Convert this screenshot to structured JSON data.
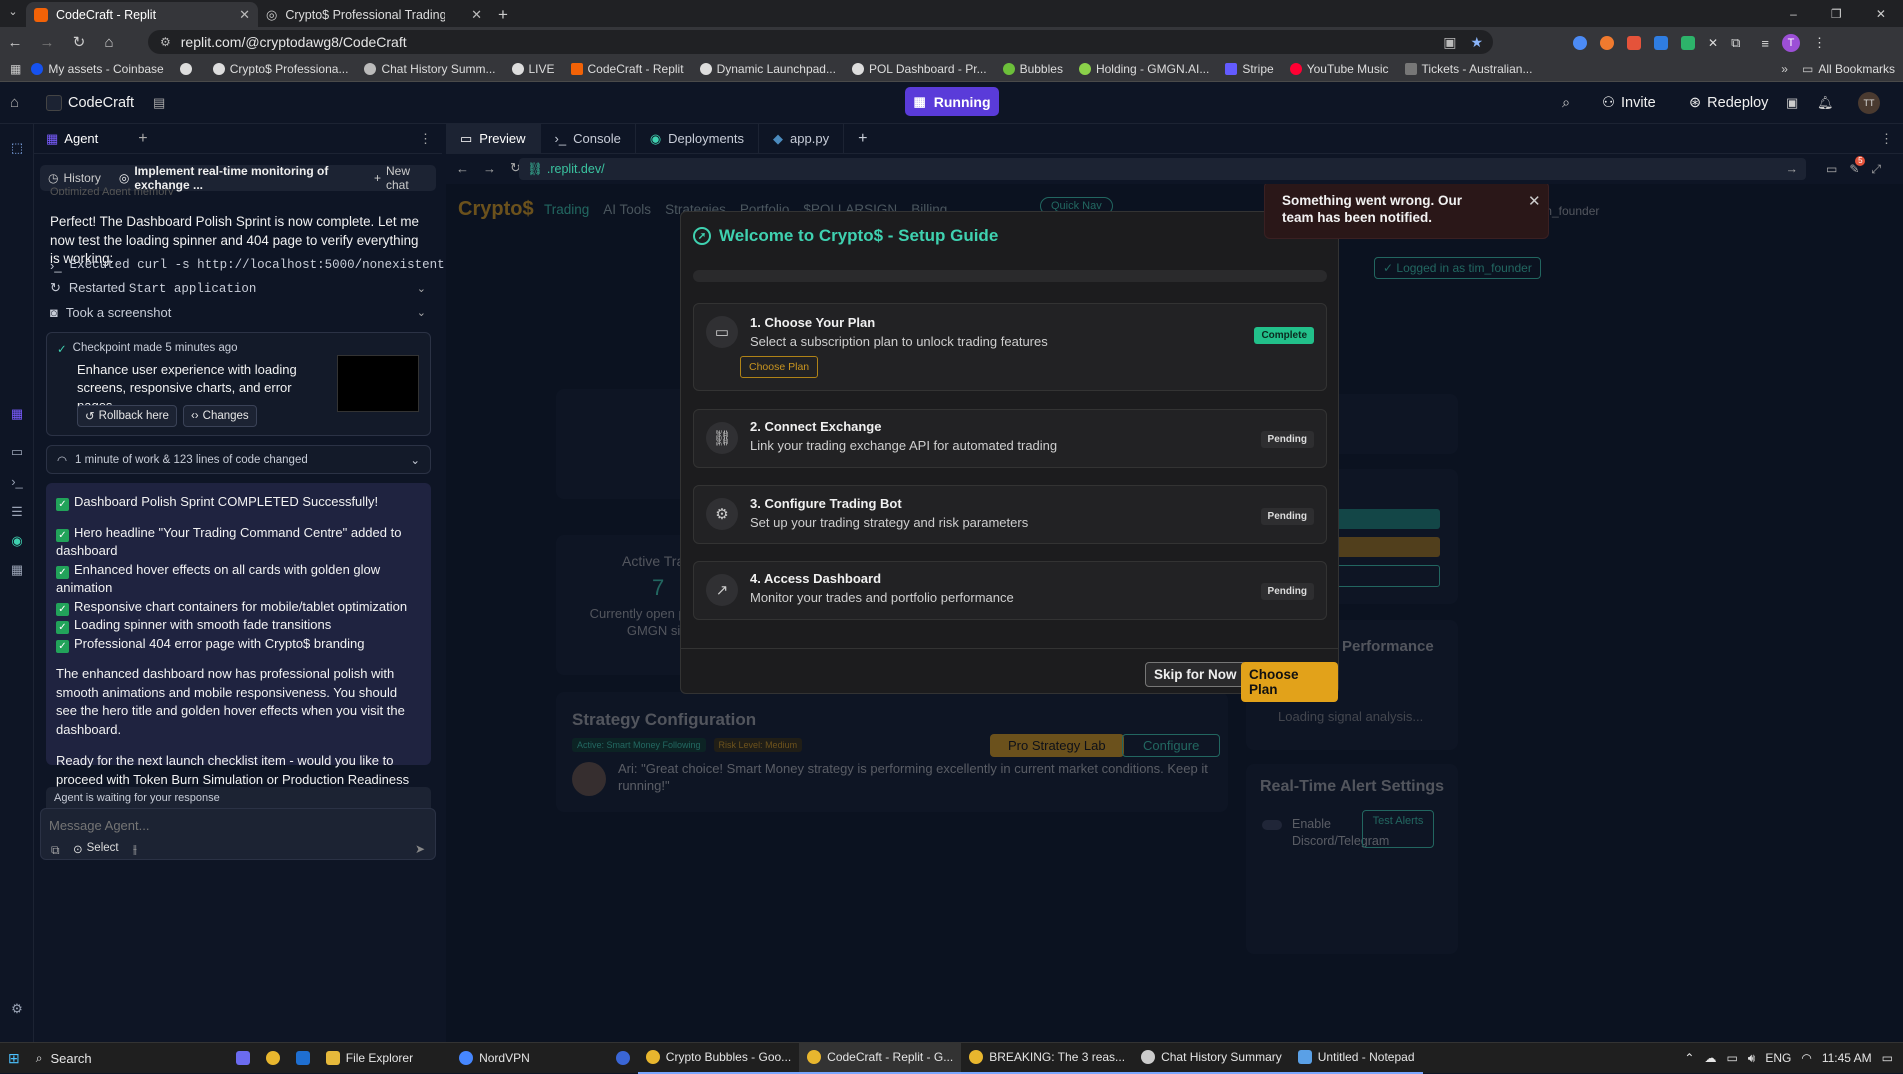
{
  "browser": {
    "tabs": [
      {
        "label": "CodeCraft - Replit",
        "active": true
      },
      {
        "label": "Crypto$ Professional Trading D",
        "active": false
      }
    ],
    "url_path": "replit.com/@cryptodawg8/CodeCraft",
    "bookmarks": [
      "My assets - Coinbase",
      "",
      "Crypto$ Professiona...",
      "Chat History Summ...",
      "LIVE",
      "CodeCraft - Replit",
      "Dynamic Launchpad...",
      "POL Dashboard - Pr...",
      "Bubbles",
      "Holding - GMGN.AI...",
      "Stripe",
      "YouTube Music",
      "Tickets - Australian..."
    ],
    "all_bookmarks": "All Bookmarks",
    "profile_initial": "T"
  },
  "replit": {
    "project_name": "CodeCraft",
    "running_label": "Running",
    "invite_label": "Invite",
    "redeploy_label": "Redeploy",
    "avatar_initials": "TT"
  },
  "agent": {
    "tab_label": "Agent",
    "history_label": "History",
    "chat_title": "Implement real-time monitoring of exchange ...",
    "new_chat_label": "New chat",
    "faded_line": "Optimized Agent memory",
    "message1": "Perfect! The Dashboard Polish Sprint is now complete. Let me now test the loading spinner and 404 page to verify everything is working:",
    "action1": "Executed curl -s http://localhost:5000/nonexistent |...",
    "action2_prefix": "Restarted ",
    "action2_code": "Start application",
    "action3": "Took a screenshot",
    "checkpoint_label": "Checkpoint made 5 minutes ago",
    "checkpoint_desc": "Enhance user experience with loading screens, responsive charts, and error pages",
    "rollback_label": "Rollback here",
    "changes_label": "Changes",
    "work_summary": "1 minute of work & 123 lines of code changed",
    "checklist": [
      "Dashboard Polish Sprint COMPLETED Successfully!",
      "Hero headline \"Your Trading Command Centre\" added to dashboard",
      "Enhanced hover effects on all cards with golden glow animation",
      "Responsive chart containers for mobile/tablet optimization",
      "Loading spinner with smooth fade transitions",
      "Professional 404 error page with Crypto$ branding"
    ],
    "para1": "The enhanced dashboard now has professional polish with smooth animations and mobile responsiveness. You should see the hero title and golden hover effects when you visit the dashboard.",
    "para2": "Ready for the next launch checklist item - would you like to proceed with Token Burn Simulation or Production Readiness checklist?",
    "waiting": "Agent is waiting for your response",
    "input_placeholder": "Message Agent...",
    "select_label": "Select"
  },
  "workspace": {
    "tabs": [
      "Preview",
      "Console",
      "Deployments",
      "app.py"
    ],
    "url": ".replit.dev/",
    "notif_count": "5"
  },
  "app": {
    "brand": "Crypto$",
    "nav": [
      "Trading",
      "AI Tools",
      "Strategies",
      "Portfolio",
      "$POLLARSIGN",
      "Billing"
    ],
    "quick_nav": "Quick Nav",
    "user": "tim_founder",
    "logged_in": "✓ Logged in as tim_founder",
    "active_trades_title": "Active Tra",
    "active_trades_value": "7",
    "active_trades_desc": "Currently open pos... on GMGN si...",
    "strategy_title": "Strategy Configuration",
    "strategy_tag1": "Active: Smart Money Following",
    "strategy_tag2": "Risk Level: Medium",
    "pro_lab": "Pro Strategy Lab",
    "configure": "Configure",
    "ari_quote": "Ari: \"Great choice! Smart Money strategy is performing excellently in current market conditions. Keep it running!\"",
    "analytics": "alytics",
    "performance": "Performance",
    "loading_signal": "Loading signal analysis...",
    "alert_title": "Real-Time Alert Settings",
    "enable_label": "Enable Discord/Telegram",
    "test_alerts": "Test Alerts"
  },
  "modal": {
    "title": "Welcome to Crypto$ - Setup Guide",
    "steps": [
      {
        "title": "1. Choose Your Plan",
        "desc": "Select a subscription plan to unlock trading features",
        "status": "Complete",
        "action": "Choose Plan"
      },
      {
        "title": "2. Connect Exchange",
        "desc": "Link your trading exchange API for automated trading",
        "status": "Pending"
      },
      {
        "title": "3. Configure Trading Bot",
        "desc": "Set up your trading strategy and risk parameters",
        "status": "Pending"
      },
      {
        "title": "4. Access Dashboard",
        "desc": "Monitor your trades and portfolio performance",
        "status": "Pending"
      }
    ],
    "skip_label": "Skip for Now",
    "choose_label": "Choose Plan"
  },
  "toast": {
    "text": "Something went wrong. Our team has been notified."
  },
  "taskbar": {
    "search": "Search",
    "items": [
      "File Explorer",
      "NordVPN",
      "Crypto Bubbles - Goo...",
      "CodeCraft - Replit - G...",
      "BREAKING: The 3 reas...",
      "Chat History Summary",
      "Untitled - Notepad"
    ],
    "lang": "ENG",
    "time": "11:45 AM"
  },
  "colors": {
    "accent_teal": "#3fd1b0",
    "replit_purple": "#5a3bd9",
    "gold": "#e2a21a",
    "complete_green": "#22c08a"
  }
}
